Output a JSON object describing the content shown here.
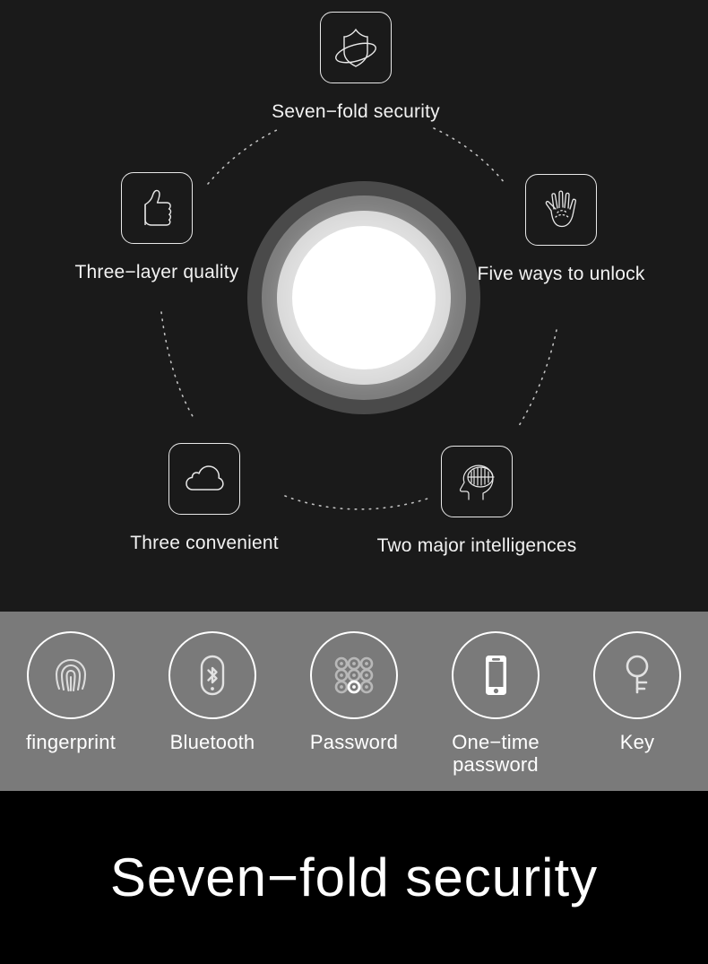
{
  "hero": {
    "center": {
      "name": "glowing-lock-disc"
    },
    "features": [
      {
        "id": "seven-fold-security",
        "label": "Seven−fold security",
        "icon": "shield-orbit-icon"
      },
      {
        "id": "three-layer-quality",
        "label": "Three−layer quality",
        "icon": "thumbs-up-icon"
      },
      {
        "id": "five-ways-to-unlock",
        "label": "Five ways to unlock",
        "icon": "open-hand-icon"
      },
      {
        "id": "three-convenient",
        "label": "Three convenient",
        "icon": "cloud-icon"
      },
      {
        "id": "two-major-intelligences",
        "label": "Two major intelligences",
        "icon": "brain-head-icon"
      }
    ]
  },
  "unlock_methods": [
    {
      "id": "fingerprint",
      "label": "fingerprint",
      "icon": "fingerprint-icon"
    },
    {
      "id": "bluetooth",
      "label": "Bluetooth",
      "icon": "bluetooth-icon"
    },
    {
      "id": "password",
      "label": "Password",
      "icon": "keypad-icon"
    },
    {
      "id": "one-time-password",
      "label": "One−time password",
      "icon": "smartphone-icon"
    },
    {
      "id": "key",
      "label": "Key",
      "icon": "key-icon"
    }
  ],
  "footer": {
    "headline": "Seven−fold security"
  },
  "colors": {
    "hero_bg": "#1a1a1a",
    "strip_bg": "#7a7a7a",
    "footer_bg": "#000000",
    "outline": "#e8e8e8",
    "text": "#ffffff"
  }
}
